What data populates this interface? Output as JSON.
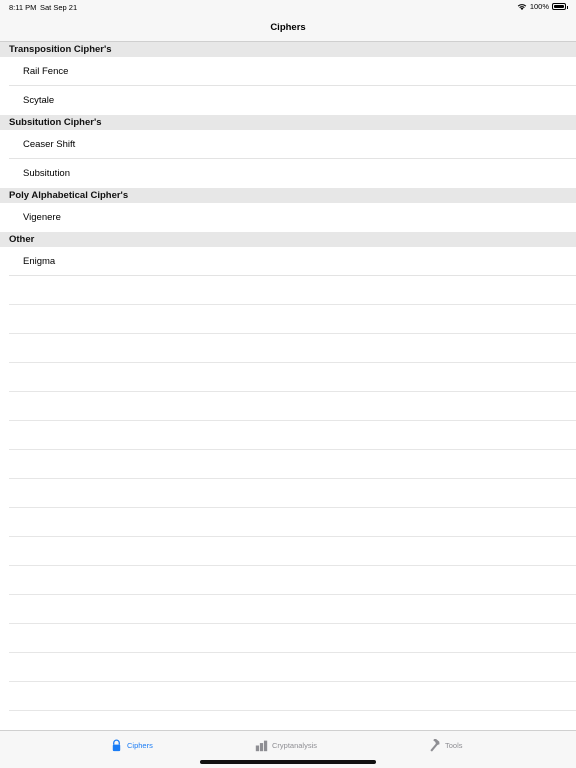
{
  "status": {
    "time": "8:11 PM",
    "date": "Sat Sep 21",
    "battery": "100%"
  },
  "nav": {
    "title": "Ciphers"
  },
  "sections": [
    {
      "header": "Transposition Cipher's",
      "rows": [
        "Rail Fence",
        "Scytale"
      ]
    },
    {
      "header": "Subsitution Cipher's",
      "rows": [
        "Ceaser Shift",
        "Subsitution"
      ]
    },
    {
      "header": "Poly Alphabetical Cipher's",
      "rows": [
        "Vigenere"
      ]
    },
    {
      "header": "Other",
      "rows": [
        "Enigma"
      ]
    }
  ],
  "tabs": [
    {
      "label": "Ciphers",
      "icon": "lock-icon",
      "active": true
    },
    {
      "label": "Cryptanalysis",
      "icon": "bar-chart-icon",
      "active": false
    },
    {
      "label": "Tools",
      "icon": "hammer-icon",
      "active": false
    }
  ],
  "colors": {
    "accent": "#1a7cf5",
    "inactive": "#8e8e93",
    "section_bg": "#e7e7e7"
  }
}
